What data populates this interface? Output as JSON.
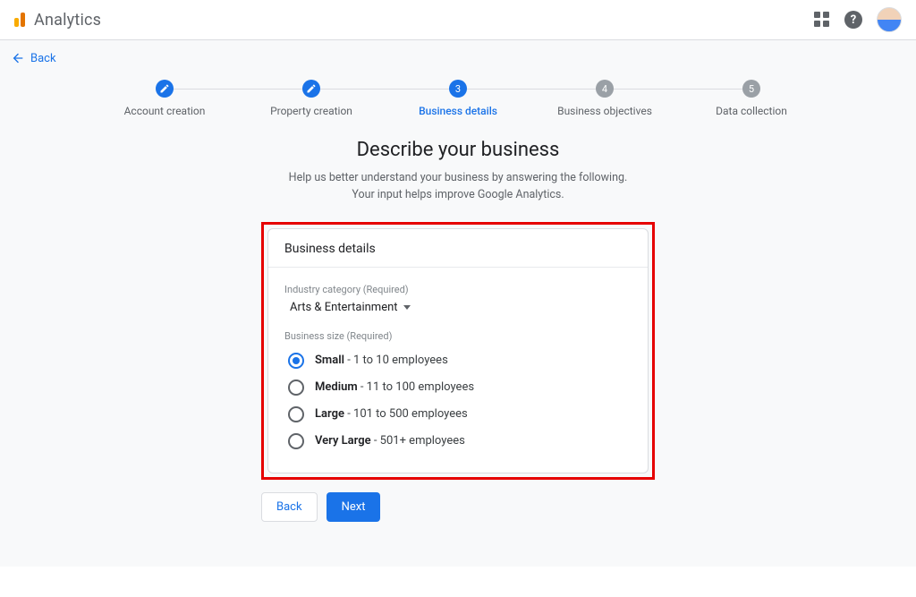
{
  "app": {
    "name": "Analytics"
  },
  "backbar": {
    "label": "Back"
  },
  "stepper": [
    {
      "label": "Account creation",
      "state": "done",
      "num": ""
    },
    {
      "label": "Property creation",
      "state": "done",
      "num": ""
    },
    {
      "label": "Business details",
      "state": "active",
      "num": "3"
    },
    {
      "label": "Business objectives",
      "state": "pending",
      "num": "4"
    },
    {
      "label": "Data collection",
      "state": "pending",
      "num": "5"
    }
  ],
  "heading": "Describe your business",
  "sub1": "Help us better understand your business by answering the following.",
  "sub2": "Your input helps improve Google Analytics.",
  "card": {
    "title": "Business details",
    "industry_label": "Industry category (Required)",
    "industry_value": "Arts & Entertainment",
    "size_label": "Business size (Required)",
    "options": [
      {
        "name": "Small",
        "desc": " - 1 to 10 employees",
        "selected": true
      },
      {
        "name": "Medium",
        "desc": " - 11 to 100 employees",
        "selected": false
      },
      {
        "name": "Large",
        "desc": " - 101 to 500 employees",
        "selected": false
      },
      {
        "name": "Very Large",
        "desc": " - 501+ employees",
        "selected": false
      }
    ]
  },
  "actions": {
    "back": "Back",
    "next": "Next"
  }
}
